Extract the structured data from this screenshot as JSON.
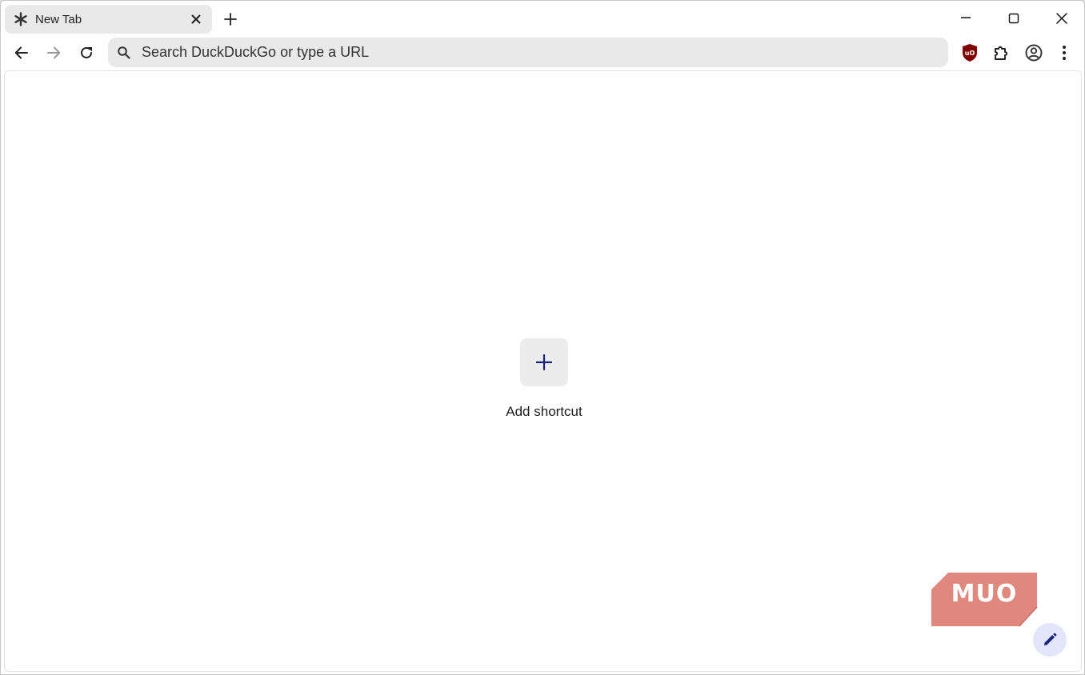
{
  "tab": {
    "title": "New Tab",
    "favicon_icon": "asterisk-icon",
    "close_icon": "close-icon"
  },
  "tabstrip": {
    "new_tab_icon": "plus-icon"
  },
  "window_controls": {
    "minimize_icon": "minimize-icon",
    "maximize_icon": "maximize-icon",
    "close_icon": "close-icon"
  },
  "toolbar": {
    "back_icon": "arrow-left-icon",
    "forward_icon": "arrow-right-icon",
    "reload_icon": "reload-icon",
    "omnibox": {
      "placeholder": "Search DuckDuckGo or type a URL",
      "value": "",
      "icon": "search-icon"
    },
    "extensions": [
      {
        "name": "ublock-origin-icon",
        "color": "#800000"
      },
      {
        "name": "puzzle-icon"
      },
      {
        "name": "profile-icon"
      },
      {
        "name": "kebab-menu-icon"
      }
    ]
  },
  "ntp": {
    "shortcut": {
      "label": "Add shortcut",
      "icon": "plus-icon"
    },
    "customize_icon": "pencil-icon"
  },
  "watermark": {
    "text": "MUO",
    "color": "#e0877e"
  },
  "colors": {
    "accent": "#1a237e",
    "tab_bg": "#e9e9e9",
    "omnibox_bg": "#e9e9e9",
    "fab_bg": "#e3e5fb"
  }
}
